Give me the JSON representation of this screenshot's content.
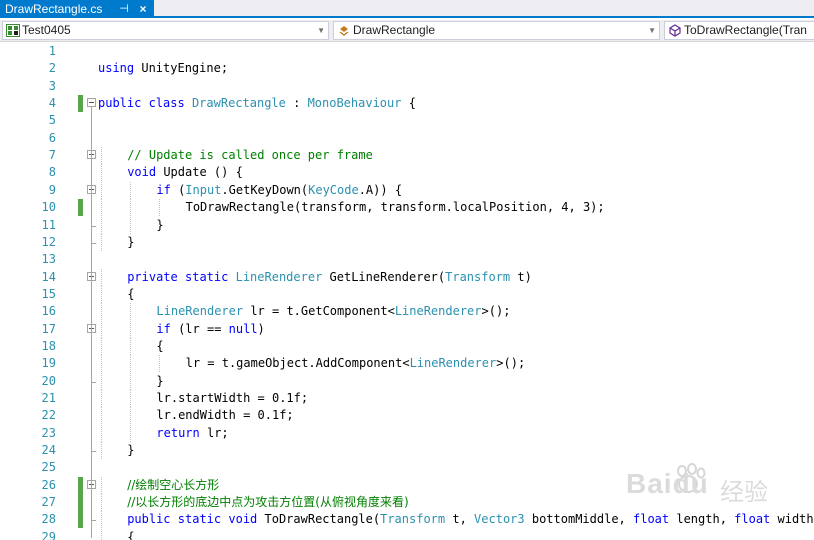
{
  "tab": {
    "title": "DrawRectangle.cs",
    "pin": "⊣",
    "close": "×"
  },
  "nav": {
    "project": "Test0405",
    "class": "DrawRectangle",
    "member": "ToDrawRectangle(Tran"
  },
  "colors": {
    "accent": "#007acc",
    "keyword": "#0000ff",
    "type": "#2b91af",
    "comment": "#008000",
    "change_marker": "#57a64a"
  },
  "editor": {
    "lines": [
      {
        "n": "1",
        "indent": 0,
        "tokens": []
      },
      {
        "n": "2",
        "indent": 0,
        "tokens": [
          [
            "kw",
            "using"
          ],
          [
            "pl",
            " UnityEngine;"
          ]
        ]
      },
      {
        "n": "3",
        "indent": 0,
        "tokens": []
      },
      {
        "n": "4",
        "indent": 0,
        "change": true,
        "fold": true,
        "tokens": [
          [
            "kw",
            "public"
          ],
          [
            "pl",
            " "
          ],
          [
            "kw",
            "class"
          ],
          [
            "pl",
            " "
          ],
          [
            "ty",
            "DrawRectangle"
          ],
          [
            "pl",
            " : "
          ],
          [
            "ty",
            "MonoBehaviour"
          ],
          [
            "pl",
            " {"
          ]
        ]
      },
      {
        "n": "5",
        "indent": 0,
        "tokens": []
      },
      {
        "n": "6",
        "indent": 0,
        "tokens": []
      },
      {
        "n": "7",
        "indent": 1,
        "fold": true,
        "tokens": [
          [
            "cm",
            "// Update is called once per frame"
          ]
        ]
      },
      {
        "n": "8",
        "indent": 1,
        "tokens": [
          [
            "kw",
            "void"
          ],
          [
            "pl",
            " Update () {"
          ]
        ]
      },
      {
        "n": "9",
        "indent": 2,
        "fold": true,
        "tokens": [
          [
            "kw",
            "if"
          ],
          [
            "pl",
            " ("
          ],
          [
            "ty",
            "Input"
          ],
          [
            "pl",
            ".GetKeyDown("
          ],
          [
            "ty",
            "KeyCode"
          ],
          [
            "pl",
            ".A)) {"
          ]
        ]
      },
      {
        "n": "10",
        "indent": 3,
        "change": true,
        "tokens": [
          [
            "pl",
            "ToDrawRectangle(transform, transform.localPosition, 4, 3);"
          ]
        ]
      },
      {
        "n": "11",
        "indent": 2,
        "tokens": [
          [
            "pl",
            "}"
          ]
        ]
      },
      {
        "n": "12",
        "indent": 1,
        "tokens": [
          [
            "pl",
            "}"
          ]
        ]
      },
      {
        "n": "13",
        "indent": 0,
        "tokens": []
      },
      {
        "n": "14",
        "indent": 1,
        "fold": true,
        "tokens": [
          [
            "kw",
            "private"
          ],
          [
            "pl",
            " "
          ],
          [
            "kw",
            "static"
          ],
          [
            "pl",
            " "
          ],
          [
            "ty",
            "LineRenderer"
          ],
          [
            "pl",
            " GetLineRenderer("
          ],
          [
            "ty",
            "Transform"
          ],
          [
            "pl",
            " t)"
          ]
        ]
      },
      {
        "n": "15",
        "indent": 1,
        "tokens": [
          [
            "pl",
            "{"
          ]
        ]
      },
      {
        "n": "16",
        "indent": 2,
        "tokens": [
          [
            "ty",
            "LineRenderer"
          ],
          [
            "pl",
            " lr = t.GetComponent<"
          ],
          [
            "ty",
            "LineRenderer"
          ],
          [
            "pl",
            ">();"
          ]
        ]
      },
      {
        "n": "17",
        "indent": 2,
        "fold": true,
        "tokens": [
          [
            "kw",
            "if"
          ],
          [
            "pl",
            " (lr == "
          ],
          [
            "kw",
            "null"
          ],
          [
            "pl",
            ")"
          ]
        ]
      },
      {
        "n": "18",
        "indent": 2,
        "tokens": [
          [
            "pl",
            "{"
          ]
        ]
      },
      {
        "n": "19",
        "indent": 3,
        "tokens": [
          [
            "pl",
            "lr = t.gameObject.AddComponent<"
          ],
          [
            "ty",
            "LineRenderer"
          ],
          [
            "pl",
            ">();"
          ]
        ]
      },
      {
        "n": "20",
        "indent": 2,
        "tokens": [
          [
            "pl",
            "}"
          ]
        ]
      },
      {
        "n": "21",
        "indent": 2,
        "tokens": [
          [
            "pl",
            "lr.startWidth = 0.1f;"
          ]
        ]
      },
      {
        "n": "22",
        "indent": 2,
        "tokens": [
          [
            "pl",
            "lr.endWidth = 0.1f;"
          ]
        ]
      },
      {
        "n": "23",
        "indent": 2,
        "tokens": [
          [
            "kw",
            "return"
          ],
          [
            "pl",
            " lr;"
          ]
        ]
      },
      {
        "n": "24",
        "indent": 1,
        "tokens": [
          [
            "pl",
            "}"
          ]
        ]
      },
      {
        "n": "25",
        "indent": 0,
        "tokens": []
      },
      {
        "n": "26",
        "indent": 1,
        "change": true,
        "fold": true,
        "tokens": [
          [
            "cm",
            "//绘制空心长方形"
          ]
        ]
      },
      {
        "n": "27",
        "indent": 1,
        "change": true,
        "tokens": [
          [
            "cm",
            "//以长方形的底边中点为攻击方位置(从俯视角度来看)"
          ]
        ]
      },
      {
        "n": "28",
        "indent": 1,
        "change": true,
        "tokens": [
          [
            "kw",
            "public"
          ],
          [
            "pl",
            " "
          ],
          [
            "kw",
            "static"
          ],
          [
            "pl",
            " "
          ],
          [
            "kw",
            "void"
          ],
          [
            "pl",
            " ToDrawRectangle("
          ],
          [
            "ty",
            "Transform"
          ],
          [
            "pl",
            " t, "
          ],
          [
            "ty",
            "Vector3"
          ],
          [
            "pl",
            " bottomMiddle, "
          ],
          [
            "kw",
            "float"
          ],
          [
            "pl",
            " length, "
          ],
          [
            "kw",
            "float"
          ],
          [
            "pl",
            " width)"
          ]
        ]
      },
      {
        "n": "29",
        "indent": 1,
        "tokens": [
          [
            "pl",
            "{"
          ]
        ]
      }
    ]
  },
  "watermark": {
    "text": "Baidu",
    "cjk": "经验"
  }
}
